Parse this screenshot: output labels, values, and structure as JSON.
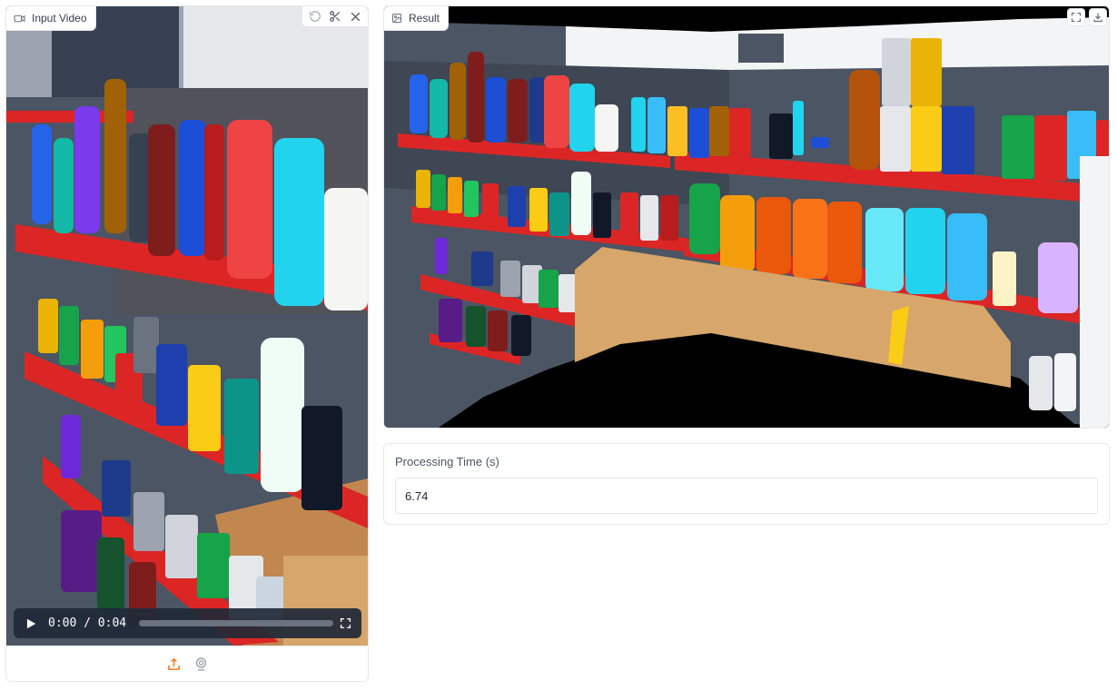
{
  "input_video": {
    "label": "Input Video",
    "icon": "video-icon",
    "toolbar": [
      "undo-icon",
      "scissors-icon",
      "close-icon"
    ],
    "player": {
      "time_display": "0:00 / 0:04",
      "progress": 0.0
    },
    "source_options": [
      "upload-icon",
      "webcam-icon"
    ],
    "accent_color": "#f97316"
  },
  "result": {
    "label": "Result",
    "icon": "image-icon",
    "toolbar": [
      "fullscreen-icon",
      "download-icon"
    ]
  },
  "processing_time": {
    "label": "Processing Time (s)",
    "value": "6.74"
  }
}
